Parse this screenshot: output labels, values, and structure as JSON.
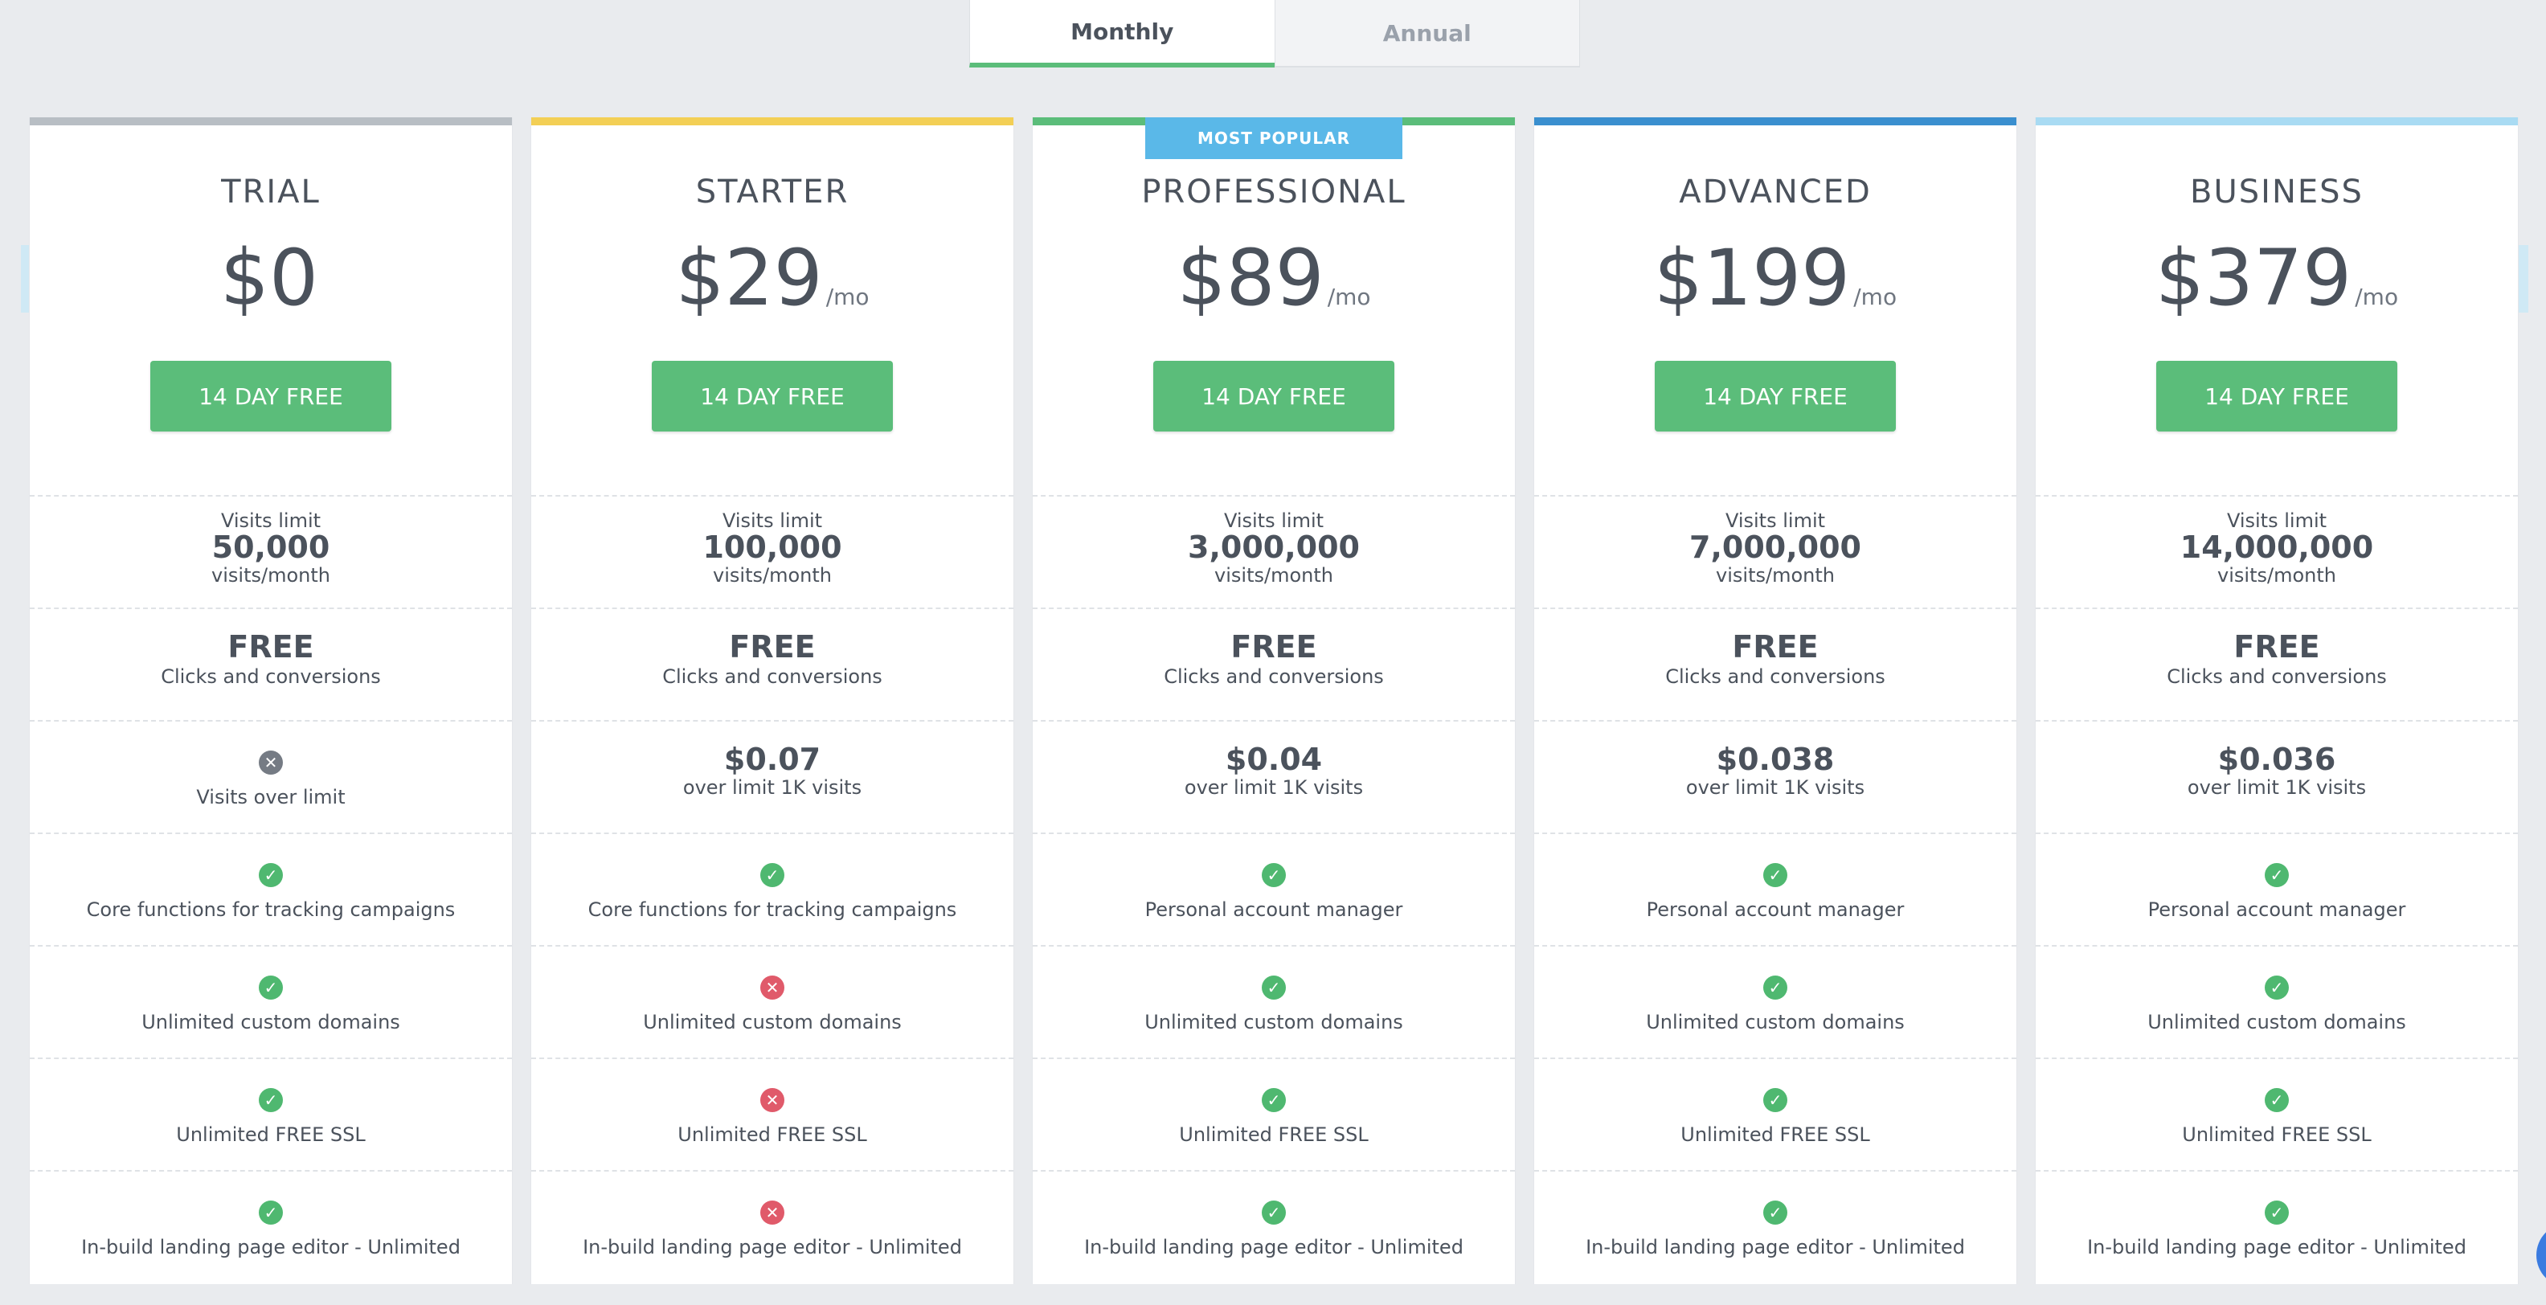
{
  "tabs": {
    "monthly": "Monthly",
    "annual": "Annual"
  },
  "badge": "MOST POPULAR",
  "plans": [
    {
      "name": "TRIAL",
      "price": "$0",
      "per": "",
      "cta": "14 DAY FREE",
      "visits_label": "Visits limit",
      "visits_value": "50,000",
      "visits_unit": "visits/month",
      "clicks_value": "FREE",
      "clicks_label": "Clicks and conversions",
      "over_value": "",
      "over_label": "Visits over limit",
      "over_icon": "cross-circle-icon",
      "features": [
        {
          "label": "Core functions for tracking campaigns",
          "icon": "check-circle-icon"
        },
        {
          "label": "Unlimited custom domains",
          "icon": "check-circle-icon"
        },
        {
          "label": "Unlimited FREE SSL",
          "icon": "check-circle-icon"
        },
        {
          "label": "In-build landing page editor - Unlimited",
          "icon": "check-circle-icon"
        }
      ]
    },
    {
      "name": "STARTER",
      "price": "$29",
      "per": "/mo",
      "cta": "14 DAY FREE",
      "visits_label": "Visits limit",
      "visits_value": "100,000",
      "visits_unit": "visits/month",
      "clicks_value": "FREE",
      "clicks_label": "Clicks and conversions",
      "over_value": "$0.07",
      "over_label": "over limit 1K visits",
      "features": [
        {
          "label": "Core functions for tracking campaigns",
          "icon": "check-circle-icon"
        },
        {
          "label": "Unlimited custom domains",
          "icon": "cross-circle-icon"
        },
        {
          "label": "Unlimited FREE SSL",
          "icon": "cross-circle-icon"
        },
        {
          "label": "In-build landing page editor - Unlimited",
          "icon": "cross-circle-icon"
        }
      ]
    },
    {
      "name": "PROFESSIONAL",
      "price": "$89",
      "per": "/mo",
      "cta": "14 DAY FREE",
      "visits_label": "Visits limit",
      "visits_value": "3,000,000",
      "visits_unit": "visits/month",
      "clicks_value": "FREE",
      "clicks_label": "Clicks and conversions",
      "over_value": "$0.04",
      "over_label": "over limit 1K visits",
      "features": [
        {
          "label": "Personal account manager",
          "icon": "check-circle-icon"
        },
        {
          "label": "Unlimited custom domains",
          "icon": "check-circle-icon"
        },
        {
          "label": "Unlimited FREE SSL",
          "icon": "check-circle-icon"
        },
        {
          "label": "In-build landing page editor - Unlimited",
          "icon": "check-circle-icon"
        }
      ]
    },
    {
      "name": "ADVANCED",
      "price": "$199",
      "per": "/mo",
      "cta": "14 DAY FREE",
      "visits_label": "Visits limit",
      "visits_value": "7,000,000",
      "visits_unit": "visits/month",
      "clicks_value": "FREE",
      "clicks_label": "Clicks and conversions",
      "over_value": "$0.038",
      "over_label": "over limit 1K visits",
      "features": [
        {
          "label": "Personal account manager",
          "icon": "check-circle-icon"
        },
        {
          "label": "Unlimited custom domains",
          "icon": "check-circle-icon"
        },
        {
          "label": "Unlimited FREE SSL",
          "icon": "check-circle-icon"
        },
        {
          "label": "In-build landing page editor - Unlimited",
          "icon": "check-circle-icon"
        }
      ]
    },
    {
      "name": "BUSINESS",
      "price": "$379",
      "per": "/mo",
      "cta": "14 DAY FREE",
      "visits_label": "Visits limit",
      "visits_value": "14,000,000",
      "visits_unit": "visits/month",
      "clicks_value": "FREE",
      "clicks_label": "Clicks and conversions",
      "over_value": "$0.036",
      "over_label": "over limit 1K visits",
      "features": [
        {
          "label": "Personal account manager",
          "icon": "check-circle-icon"
        },
        {
          "label": "Unlimited custom domains",
          "icon": "check-circle-icon"
        },
        {
          "label": "Unlimited FREE SSL",
          "icon": "check-circle-icon"
        },
        {
          "label": "In-build landing page editor - Unlimited",
          "icon": "check-circle-icon"
        }
      ]
    }
  ],
  "colors": {
    "accent_green": "#5bbd7a",
    "bar_trial": "#b8bec4",
    "bar_starter": "#f3cf55",
    "bar_professional": "#5bbd7a",
    "bar_advanced": "#3a8fcf",
    "bar_business": "#a9dbf3",
    "badge_blue": "#5ab8e8",
    "cross_red": "#e05a6a"
  },
  "nav": {
    "prev_icon": "chevron-left-icon",
    "next_icon": "chevron-right-icon"
  }
}
